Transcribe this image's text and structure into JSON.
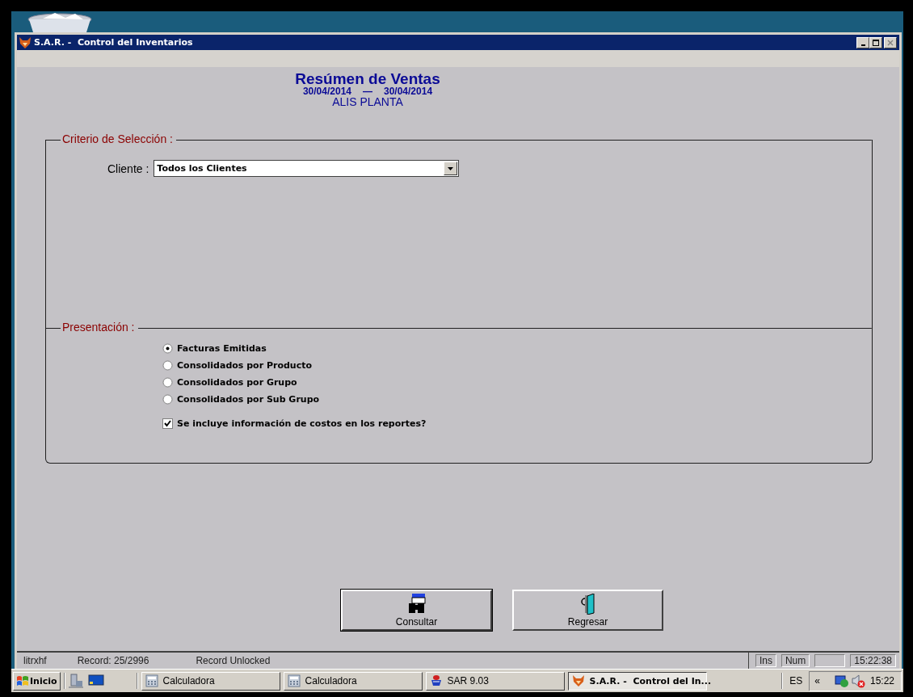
{
  "window": {
    "title": "S.A.R. -  Control del Inventarios"
  },
  "header": {
    "title": "Resúmen de Ventas",
    "date_from": "30/04/2014",
    "separator": "—",
    "date_to": "30/04/2014",
    "location": "ALIS PLANTA"
  },
  "criteria": {
    "title": "Criterio de Selección :",
    "fields": [
      {
        "label": "Cliente :",
        "value": "Todos los Clientes"
      }
    ]
  },
  "presentation": {
    "title": "Presentación :",
    "options": [
      {
        "label": "Facturas Emitidas",
        "selected": true
      },
      {
        "label": "Consolidados por Producto",
        "selected": false
      },
      {
        "label": "Consolidados por Grupo",
        "selected": false
      },
      {
        "label": "Consolidados por Sub Grupo",
        "selected": false
      }
    ],
    "include_costs": {
      "label": "Se incluye información de costos en los reportes?",
      "checked": true
    }
  },
  "buttons": [
    {
      "label": "Consultar",
      "kind": "query",
      "default": true
    },
    {
      "label": "Regresar",
      "kind": "exit",
      "default": false
    }
  ],
  "status_bar": {
    "user": "litrxhf",
    "record": "Record: 25/2996",
    "lock": "Record Unlocked",
    "indicators": [
      "Ins",
      "Num"
    ],
    "clock": "15:22:38"
  },
  "taskbar": {
    "start": "Inicio",
    "tasks": [
      {
        "label": "Calculadora",
        "kind": "calculator",
        "selected": false
      },
      {
        "label": "Calculadora",
        "kind": "calculator",
        "selected": false
      },
      {
        "label": "SAR 9.03",
        "kind": "sar",
        "selected": false
      },
      {
        "label": "S.A.R. -  Control del In...",
        "kind": "app",
        "selected": true
      }
    ],
    "language": "ES",
    "tray_toggle": "«",
    "clock": "15:22"
  }
}
